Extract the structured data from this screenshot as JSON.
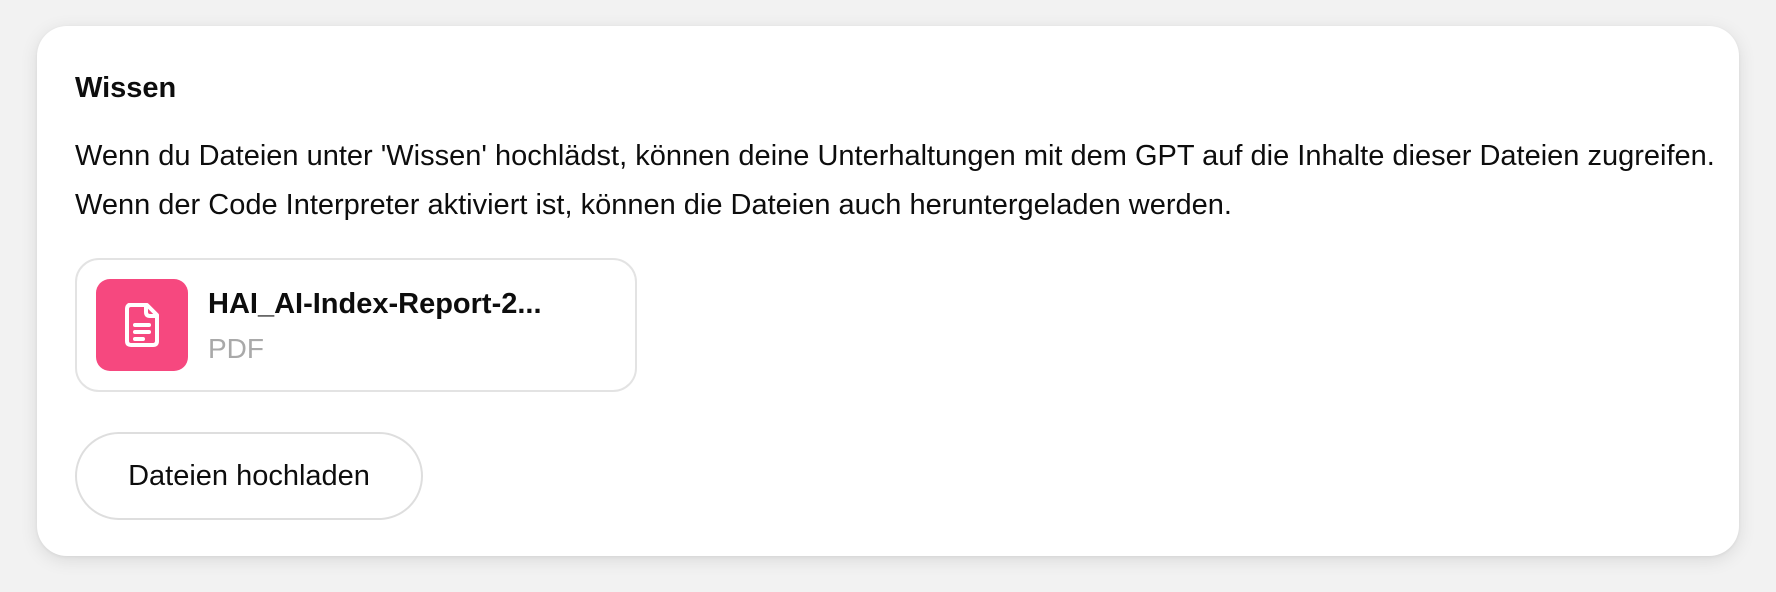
{
  "knowledge": {
    "title": "Wissen",
    "description": "Wenn du Dateien unter 'Wissen' hochlädst, können deine Unterhaltungen mit dem GPT auf die Inhalte dieser Dateien zugreifen. Wenn der Code Interpreter aktiviert ist, können die Dateien auch heruntergeladen werden.",
    "files": [
      {
        "name": "HAI_AI-Index-Report-2...",
        "type": "PDF",
        "icon": "document-icon",
        "icon_color": "#f6487f"
      }
    ],
    "upload_button_label": "Dateien hochladen"
  }
}
